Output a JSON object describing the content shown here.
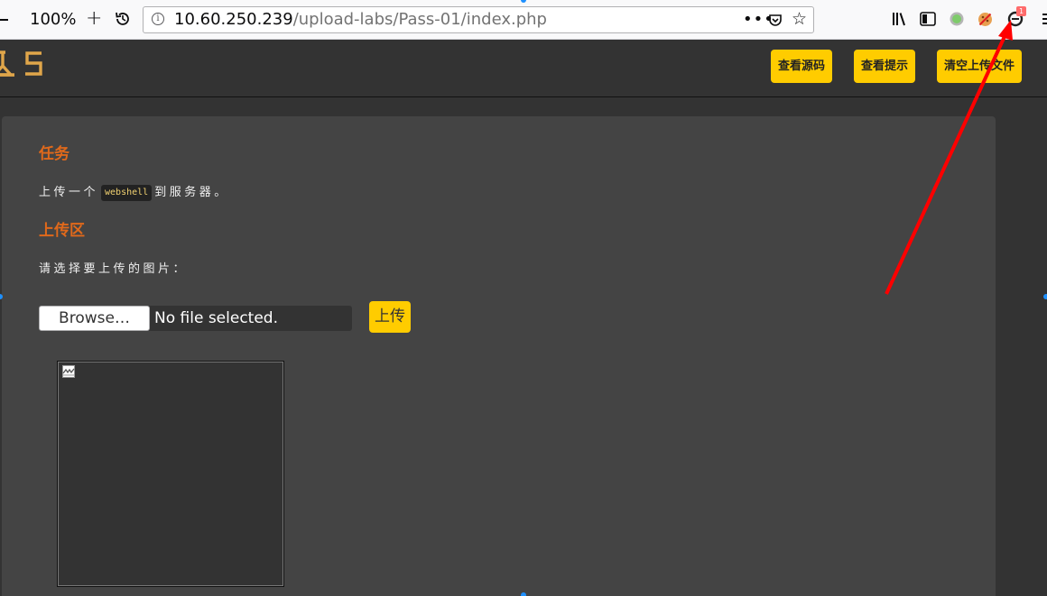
{
  "browser": {
    "zoom_level": "100%",
    "url_host": "10.60.250.239",
    "url_path": "/upload-labs/Pass-01/index.php",
    "page_actions": "•••",
    "extension_badge": "1"
  },
  "header": {
    "buttons": [
      {
        "label": "查看源码"
      },
      {
        "label": "查看提示"
      },
      {
        "label": "清空上传文件"
      }
    ]
  },
  "task": {
    "title": "任务",
    "text_before": "上传一个",
    "code": "webshell",
    "text_after": "到服务器。"
  },
  "upload": {
    "title": "上传区",
    "prompt": "请选择要上传的图片：",
    "browse_label": "Browse…",
    "file_status": "No file selected.",
    "submit_label": "上传"
  },
  "colors": {
    "accent_yellow": "#ffcc00",
    "section_title": "#e0691b",
    "panel_bg": "#444444",
    "page_bg": "#333333",
    "annotation_arrow": "#ff0000"
  }
}
